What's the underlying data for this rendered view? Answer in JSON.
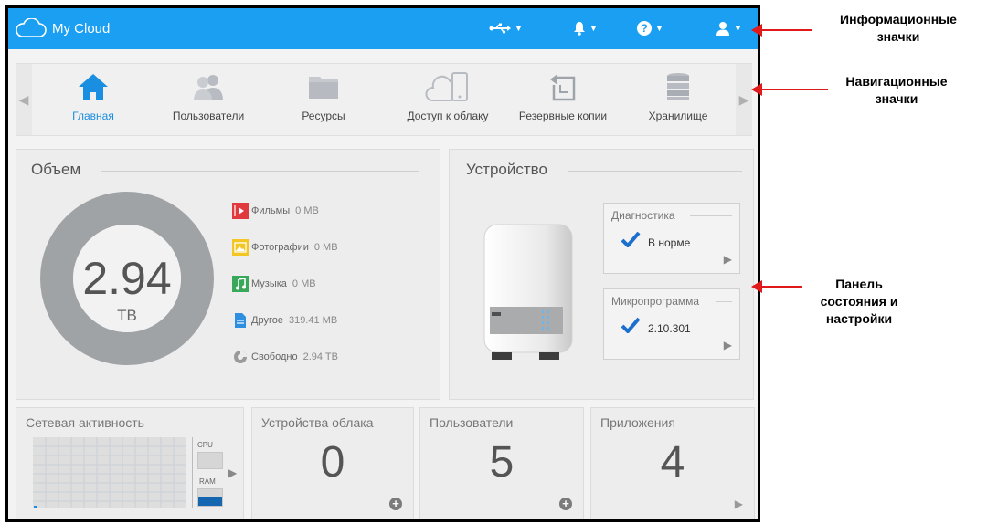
{
  "app": {
    "title": "My Cloud"
  },
  "colors": {
    "accent": "#1a9ff2",
    "arrow": "#e0191b",
    "check": "#1a6fcf"
  },
  "topbar_icons": [
    "usb-icon",
    "bell-icon",
    "help-icon",
    "user-icon"
  ],
  "nav": {
    "items": [
      {
        "label": "Главная",
        "icon": "home-icon",
        "active": true
      },
      {
        "label": "Пользователи",
        "icon": "users-icon",
        "active": false
      },
      {
        "label": "Ресурсы",
        "icon": "folder-icon",
        "active": false
      },
      {
        "label": "Доступ к облаку",
        "icon": "cloud-device-icon",
        "active": false
      },
      {
        "label": "Резервные копии",
        "icon": "backup-icon",
        "active": false
      },
      {
        "label": "Хранилище",
        "icon": "storage-icon",
        "active": false
      }
    ]
  },
  "capacity": {
    "title": "Объем",
    "value": "2.94",
    "unit": "TB",
    "legend": [
      {
        "label": "Фильмы",
        "value": "0 MB",
        "icon": "film-icon",
        "color": "#e0393e"
      },
      {
        "label": "Фотографии",
        "value": "0 MB",
        "icon": "photo-icon",
        "color": "#f3c623"
      },
      {
        "label": "Музыка",
        "value": "0 MB",
        "icon": "music-icon",
        "color": "#3aa85a"
      },
      {
        "label": "Другое",
        "value": "319.41 MB",
        "icon": "document-icon",
        "color": "#2e8fe0"
      },
      {
        "label": "Свободно",
        "value": "2.94 TB",
        "icon": "free-space-icon",
        "color": "#9a9a9a"
      }
    ]
  },
  "device": {
    "title": "Устройство",
    "diagnostics": {
      "title": "Диагностика",
      "value": "В норме"
    },
    "firmware": {
      "title": "Микропрограмма",
      "value": "2.10.301"
    }
  },
  "network": {
    "title": "Сетевая активность",
    "cpu_label": "CPU",
    "ram_label": "RAM"
  },
  "cloud_devices": {
    "title": "Устройства облака",
    "count": "0"
  },
  "users": {
    "title": "Пользователи",
    "count": "5"
  },
  "apps": {
    "title": "Приложения",
    "count": "4"
  },
  "annotations": {
    "info": "Информационные значки",
    "nav": "Навигационные значки",
    "status": "Панель состояния и настройки"
  }
}
